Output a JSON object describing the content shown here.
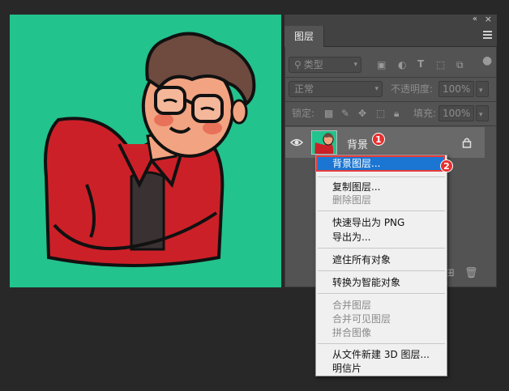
{
  "panel": {
    "tab_label": "图层",
    "filter_kind": "类型",
    "blend_mode": "正常",
    "opacity_label": "不透明度:",
    "opacity_value": "100%",
    "lock_label": "锁定:",
    "fill_label": "填充:",
    "fill_value": "100%"
  },
  "layer": {
    "name": "背景"
  },
  "badges": {
    "one": "1",
    "two": "2"
  },
  "menu": {
    "items": [
      "背景图层...",
      "复制图层...",
      "删除图层",
      "快速导出为 PNG",
      "导出为...",
      "遮住所有对象",
      "转换为智能对象",
      "合并图层",
      "合并可见图层",
      "拼合图像",
      "从文件新建 3D 图层...",
      "明信片"
    ]
  },
  "colors": {
    "canvas_bg": "#22c38c",
    "menu_highlight": "#1a76d2",
    "badge": "#e73030"
  }
}
